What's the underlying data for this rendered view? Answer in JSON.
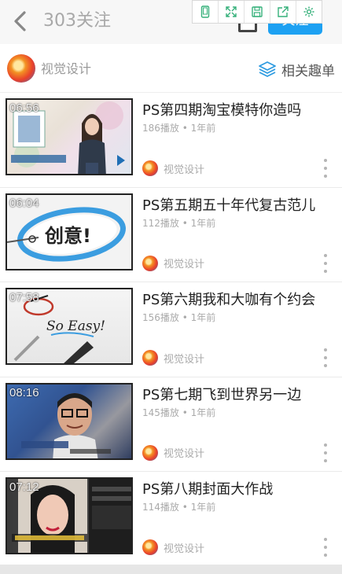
{
  "header": {
    "title": "303关注",
    "follow_label": "关注",
    "toolbar": [
      "phone-frame-icon",
      "expand-icon",
      "save-icon",
      "share-icon",
      "gear-icon"
    ]
  },
  "channel": {
    "name": "视觉设计",
    "related_label": "相关趣单"
  },
  "videos": [
    {
      "duration": "06:56",
      "title": "PS第四期淘宝模特你造吗",
      "meta": "186播放 • 1年前",
      "author": "视觉设计"
    },
    {
      "duration": "06:04",
      "title": "PS第五期五十年代复古范儿",
      "meta": "112播放 • 1年前",
      "author": "视觉设计"
    },
    {
      "duration": "07:58",
      "title": "PS第六期我和大咖有个约会",
      "meta": "156播放 • 1年前",
      "author": "视觉设计"
    },
    {
      "duration": "08:16",
      "title": "PS第七期飞到世界另一边",
      "meta": "145播放 • 1年前",
      "author": "视觉设计"
    },
    {
      "duration": "07:12",
      "title": "PS第八期封面大作战",
      "meta": "114播放 • 1年前",
      "author": "视觉设计"
    }
  ],
  "thumbnail_captions": {
    "v2": "创意!",
    "v3": "So Easy!"
  },
  "colors": {
    "accent": "#1da1f2",
    "header_bg": "#f7f7f7",
    "title_gray": "#a8a8a8"
  }
}
